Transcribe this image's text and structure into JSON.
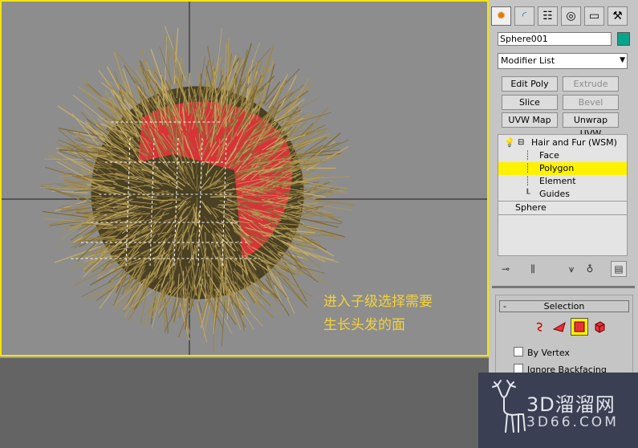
{
  "annotation": {
    "line1": "进入子级选择需要",
    "line2": "生长头发的面"
  },
  "command_panel": {
    "tabs": [
      {
        "name": "create-icon",
        "glyph": "✹"
      },
      {
        "name": "modify-icon",
        "glyph": "◜"
      },
      {
        "name": "hierarchy-icon",
        "glyph": "☷"
      },
      {
        "name": "motion-icon",
        "glyph": "◎"
      },
      {
        "name": "display-icon",
        "glyph": "▭"
      },
      {
        "name": "utilities-icon",
        "glyph": "⚒"
      }
    ],
    "object_name": "Sphere001",
    "object_color": "#0aa48a",
    "modifier_list_label": "Modifier List",
    "buttons": {
      "edit_poly": "Edit Poly",
      "extrude": "Extrude",
      "slice": "Slice",
      "bevel": "Bevel",
      "uvw_map": "UVW Map",
      "unwrap_uvw": "Unwrap UVW"
    },
    "stack": {
      "modifier": "Hair and Fur (WSM)",
      "sublevels": [
        "Face",
        "Polygon",
        "Element",
        "Guides"
      ],
      "selected_sublevel": "Polygon",
      "base_object": "Sphere"
    },
    "selection_rollout": {
      "title": "Selection",
      "collapse_symbol": "-",
      "by_vertex": "By Vertex",
      "ignore_backfacing": "Ignore Backfacing"
    }
  },
  "watermark": {
    "title": "3D溜溜网",
    "url": "3D66.COM"
  },
  "colors": {
    "selection_highlight": "#fff200",
    "viewport_border": "#f4e600",
    "annotation_text": "#f5d23a",
    "selected_faces": "#e8323a"
  }
}
